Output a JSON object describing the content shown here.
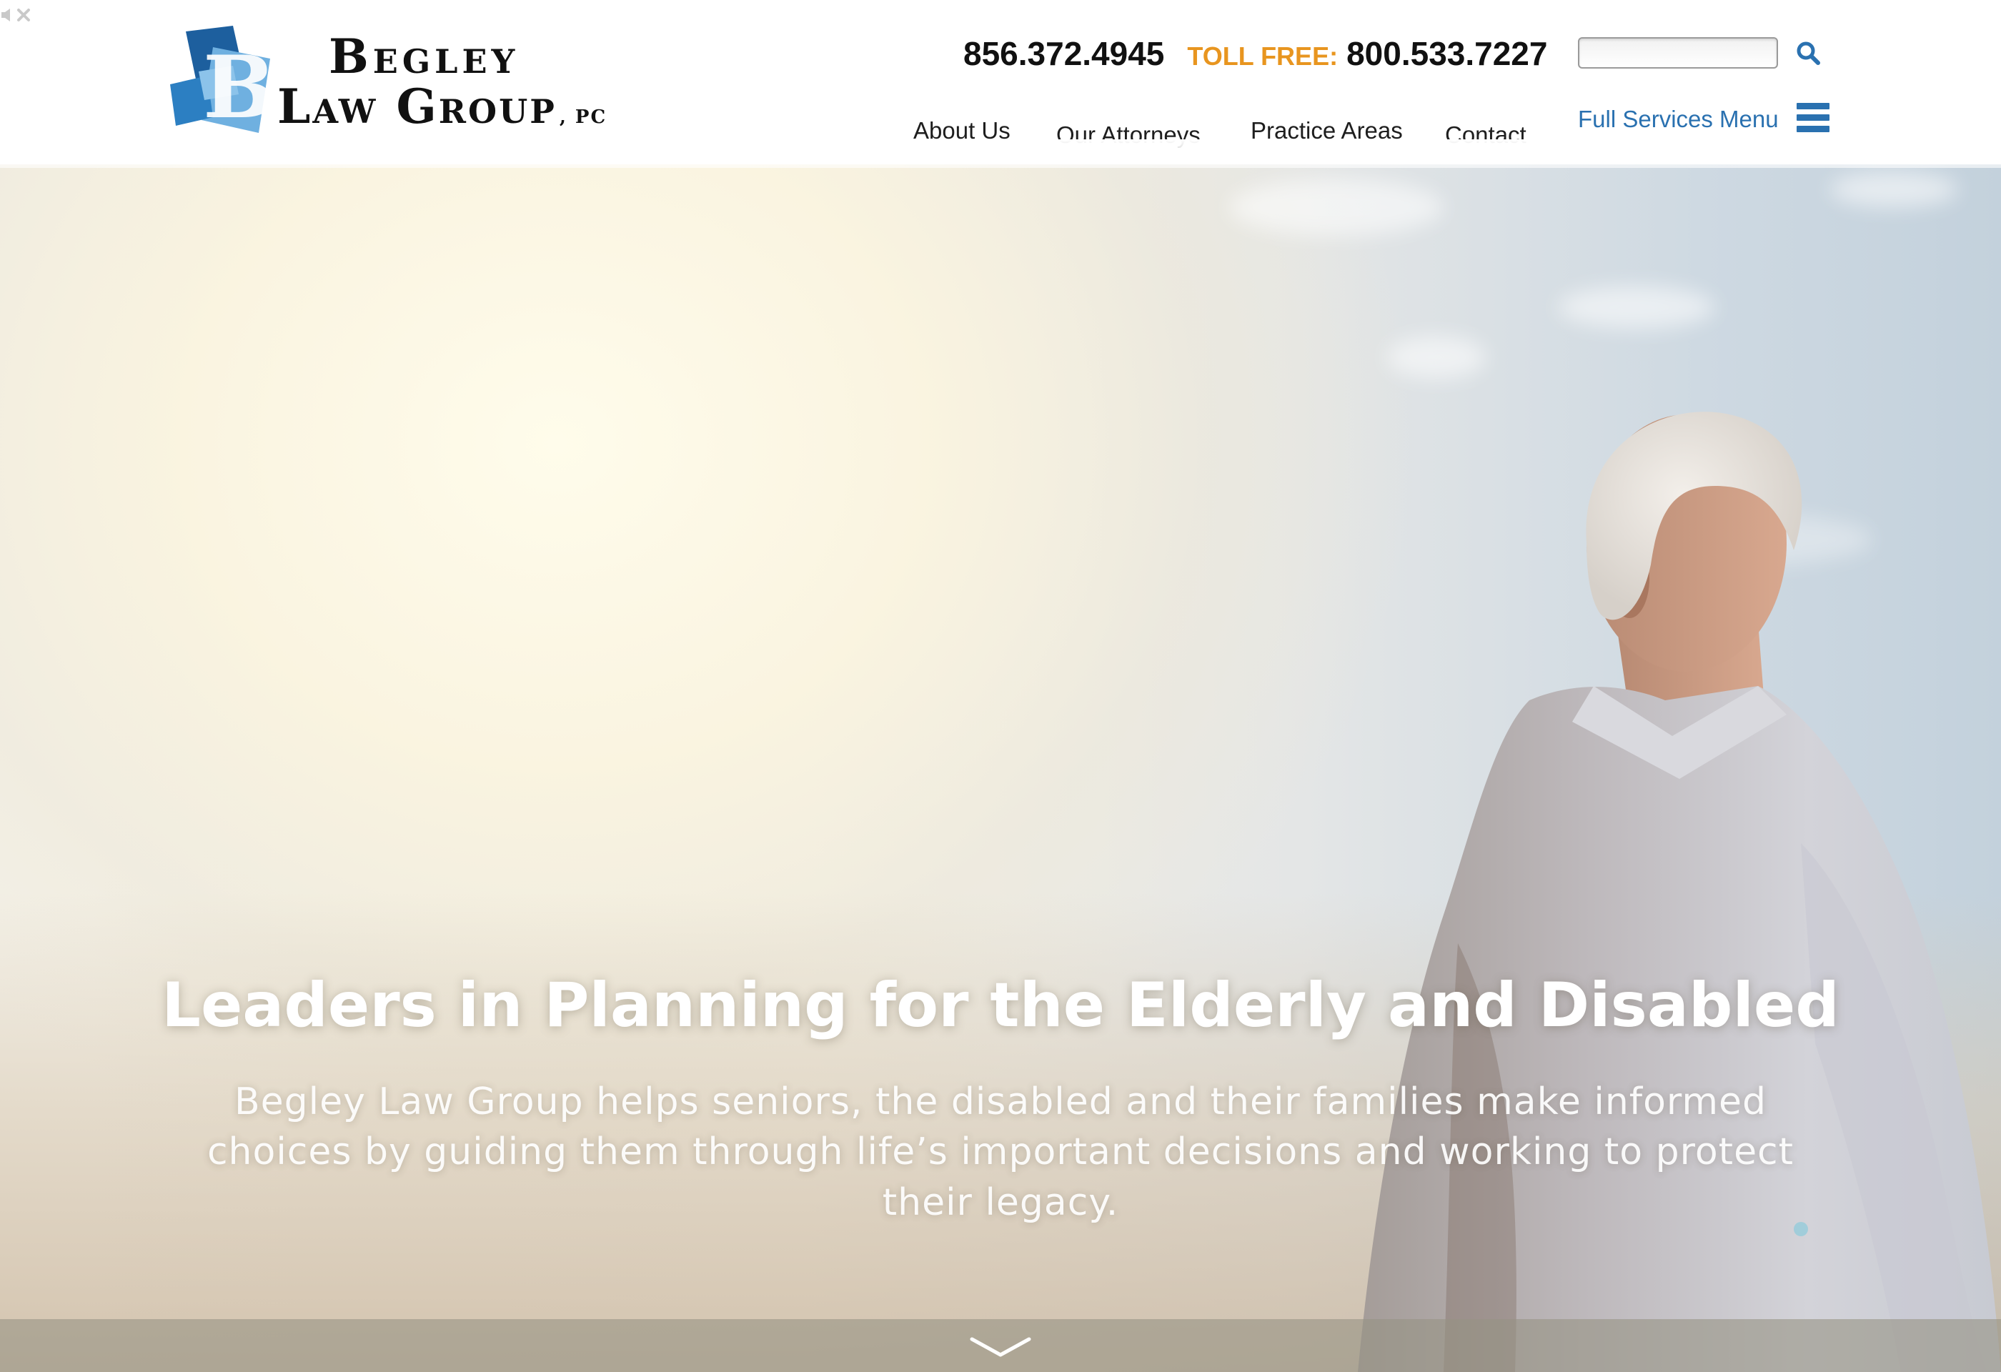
{
  "header": {
    "logo": {
      "line1": "Begley",
      "line2": "Law Group",
      "suffix": ", PC"
    },
    "phone": "856.372.4945",
    "toll_free_label": "TOLL FREE:",
    "toll_free_phone": "800.533.7227",
    "search": {
      "value": "",
      "placeholder": ""
    },
    "nav": [
      {
        "label": "About Us"
      },
      {
        "label": "Our Attorneys"
      },
      {
        "label": "Practice Areas"
      },
      {
        "label": "Contact"
      }
    ],
    "full_services_label": "Full Services Menu"
  },
  "hero": {
    "title": "Leaders in Planning for the Elderly and Disabled",
    "subtitle": "Begley Law Group helps seniors, the disabled and their families make informed choices by guiding them through life’s important decisions and working to protect their legacy."
  },
  "colors": {
    "accent_blue": "#2a71b0",
    "toll_free_orange": "#e8951f",
    "logo_blue_dark": "#1d5f9e",
    "logo_blue_light": "#6fb0e0"
  },
  "icons": {
    "mute": "speaker-mute-icon",
    "close": "close-icon",
    "search": "search-icon",
    "menu": "hamburger-menu-icon",
    "scroll": "chevron-down-icon"
  }
}
